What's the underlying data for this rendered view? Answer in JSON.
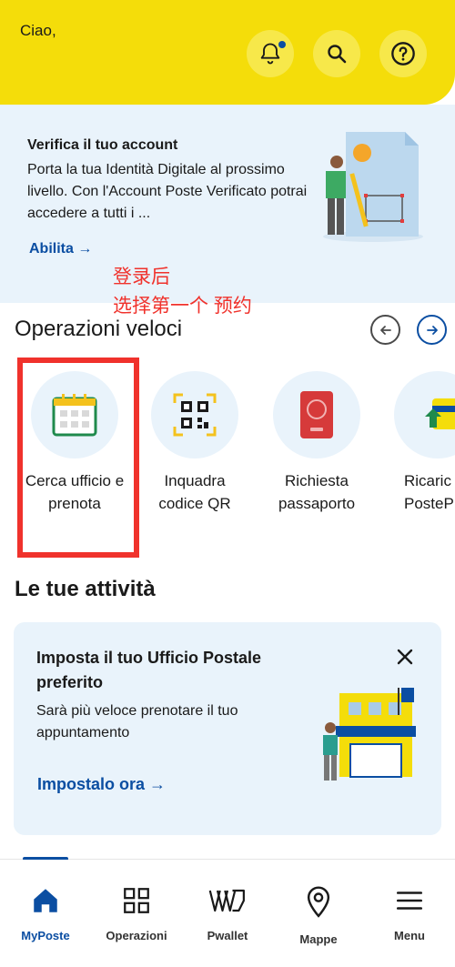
{
  "header": {
    "greeting": "Ciao,"
  },
  "banner": {
    "title": "Verifica il tuo account",
    "text": "Porta la tua Identità Digitale al prossimo livello. Con l'Account Poste Verificato potrai accedere a tutti i ...",
    "link": "Abilita →"
  },
  "annotation": {
    "line1": "登录后",
    "line2": "选择第一个 预约"
  },
  "quick_ops": {
    "title": "Operazioni veloci",
    "items": [
      {
        "label": "Cerca ufficio e prenota",
        "icon": "calendar-icon"
      },
      {
        "label": "Inquadra codice QR",
        "icon": "qr-code-icon"
      },
      {
        "label": "Richiesta passaporto",
        "icon": "passport-icon"
      },
      {
        "label": "Ricaric PosteP",
        "icon": "card-icon"
      }
    ]
  },
  "activities": {
    "title": "Le tue attività",
    "card": {
      "title": "Imposta il tuo Ufficio Postale preferito",
      "text": "Sarà più veloce prenotare il tuo appuntamento",
      "link": "Impostalo ora →"
    }
  },
  "nav": {
    "items": [
      {
        "label": "MyPoste",
        "icon": "home-icon",
        "active": true
      },
      {
        "label": "Operazioni",
        "icon": "grid-icon"
      },
      {
        "label": "Pwallet",
        "icon": "wallet-icon"
      },
      {
        "label": "Mappe",
        "icon": "map-pin-icon"
      },
      {
        "label": "Menu",
        "icon": "menu-icon"
      }
    ]
  },
  "colors": {
    "brand_yellow": "#f4dd0a",
    "brand_blue": "#0b4ea2",
    "light_blue": "#e9f3fb",
    "annotation_red": "#f0322c"
  }
}
